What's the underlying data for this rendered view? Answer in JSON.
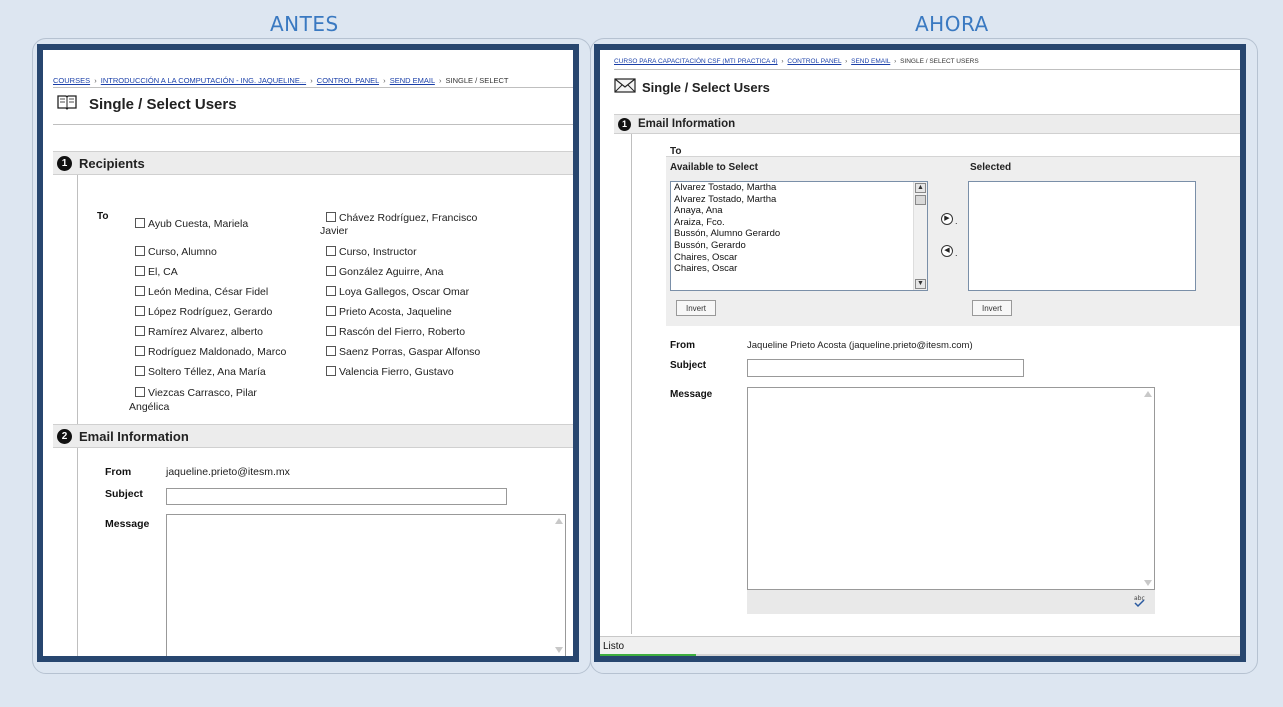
{
  "slide": {
    "left_title": "ANTES",
    "right_title": "AHORA"
  },
  "before": {
    "breadcrumb": {
      "courses": "COURSES",
      "course": "INTRODUCCIÓN A LA COMPUTACIÓN - ING. JAQUELINE...",
      "control_panel": "CONTROL PANEL",
      "send_email": "SEND EMAIL",
      "current": "SINGLE / SELECT",
      "separator": "›"
    },
    "page_title": "Single / Select Users",
    "section1": {
      "number": "1",
      "title": "Recipients"
    },
    "to_label": "To",
    "recipients_col1": [
      "Ayub Cuesta, Mariela",
      "Curso, Alumno",
      "El, CA",
      "León Medina, César Fidel",
      "López Rodríguez, Gerardo",
      "Ramírez Alvarez, alberto",
      "Rodríguez Maldonado, Marco",
      "Soltero Téllez, Ana María"
    ],
    "recipients_col2": [
      "Chávez Rodríguez, Francisco",
      "Curso, Instructor",
      "González Aguirre, Ana",
      "Loya Gallegos, Oscar Omar",
      "Prieto Acosta, Jaqueline",
      "Rascón del Fierro, Roberto",
      "Saenz Porras, Gaspar Alfonso",
      "Valencia Fierro, Gustavo"
    ],
    "recipient_wrap_2": "Javier",
    "recipient_last": "Viezcas Carrasco, Pilar",
    "recipient_last_wrap": "Angélica",
    "section2": {
      "number": "2",
      "title": "Email Information"
    },
    "from_label": "From",
    "from_value": "jaqueline.prieto@itesm.mx",
    "subject_label": "Subject",
    "subject_value": "",
    "message_label": "Message",
    "message_value": ""
  },
  "after": {
    "breadcrumb": {
      "course": "CURSO PARA CAPACITACIÓN CSF (MTI PRACTICA 4)",
      "control_panel": "CONTROL PANEL",
      "send_email": "SEND EMAIL",
      "current": "SINGLE / SELECT USERS",
      "separator": "›"
    },
    "page_title": "Single / Select Users",
    "section1": {
      "number": "1",
      "title": "Email Information"
    },
    "to_label": "To",
    "available_label": "Available to Select",
    "selected_label": "Selected",
    "available_list": [
      "Alvarez Tostado, Martha",
      "Alvarez Tostado, Martha",
      "Anaya, Ana",
      "Araiza, Fco.",
      "Bussón, Alumno Gerardo",
      "Bussón, Gerardo",
      "Chaires, Oscar",
      "Chaires, Oscar"
    ],
    "invert_label_left": "Invert",
    "invert_label_right": "Invert",
    "from_label": "From",
    "from_value": "Jaqueline Prieto Acosta (jaqueline.prieto@itesm.com)",
    "subject_label": "Subject",
    "subject_value": "",
    "message_label": "Message",
    "message_value": "",
    "status_text": "Listo"
  },
  "icons": {
    "before_title_icon": "book-icon",
    "after_title_icon": "envelope-icon",
    "spellcheck_icon": "spellcheck-icon"
  },
  "colors": {
    "frame": "#27466f",
    "slide_title": "#3a79c1",
    "background": "#dde6f1",
    "link": "#1a3fa8"
  }
}
